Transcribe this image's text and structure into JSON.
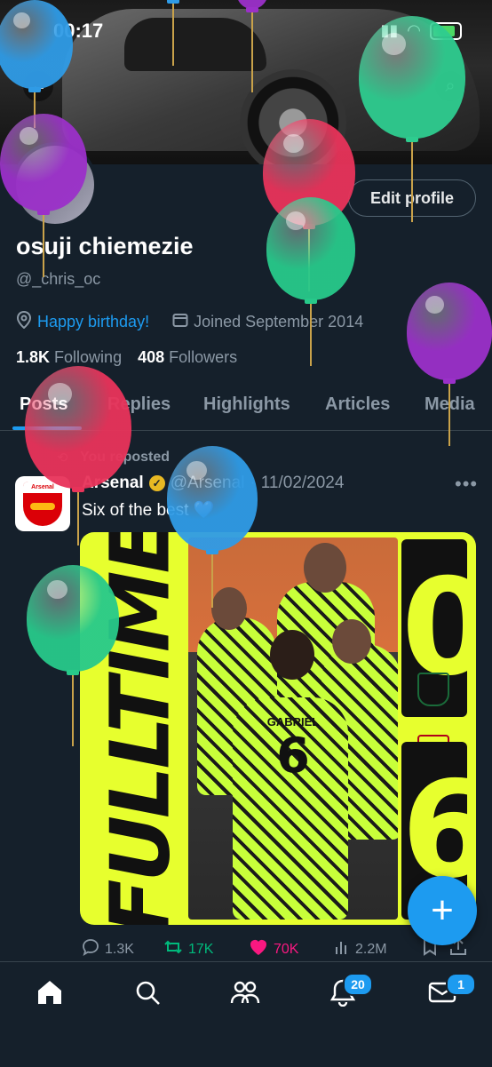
{
  "status_bar": {
    "time": "00:17"
  },
  "banner": {
    "back_icon": "arrow-left-icon",
    "search_icon": "search-icon"
  },
  "profile": {
    "edit_label": "Edit profile",
    "display_name": "osuji chiemezie",
    "handle": "@_chris_oc",
    "bio_link": "Happy birthday!",
    "joined": "Joined September 2014",
    "following_count": "1.8K",
    "following_label": "Following",
    "followers_count": "408",
    "followers_label": "Followers"
  },
  "tabs": [
    "Posts",
    "Replies",
    "Highlights",
    "Articles",
    "Media"
  ],
  "tweet": {
    "reposted_label": "You reposted",
    "author_name": "Arsenal",
    "author_handle": "@Arsenal",
    "date": "11/02/2024",
    "text": "Six of the best 💙",
    "avatar_text": "Arsenal",
    "media": {
      "banner_text": "FULLTIME",
      "score_home": "0",
      "score_away": "6",
      "jersey_name": "GABRIEL",
      "jersey_number": "6"
    },
    "stats": {
      "replies": "1.3K",
      "reposts": "17K",
      "likes": "70K",
      "views": "2.2M"
    }
  },
  "bottom_nav": {
    "items": [
      "home-icon",
      "search-icon",
      "communities-icon",
      "notifications-icon",
      "messages-icon"
    ],
    "notifications_badge": "20",
    "messages_badge": "1"
  },
  "colors": {
    "background": "#15202b",
    "accent": "#1d9bf0",
    "repost": "#00ba7c",
    "like": "#f91880",
    "media_yellow": "#e7ff2e"
  }
}
